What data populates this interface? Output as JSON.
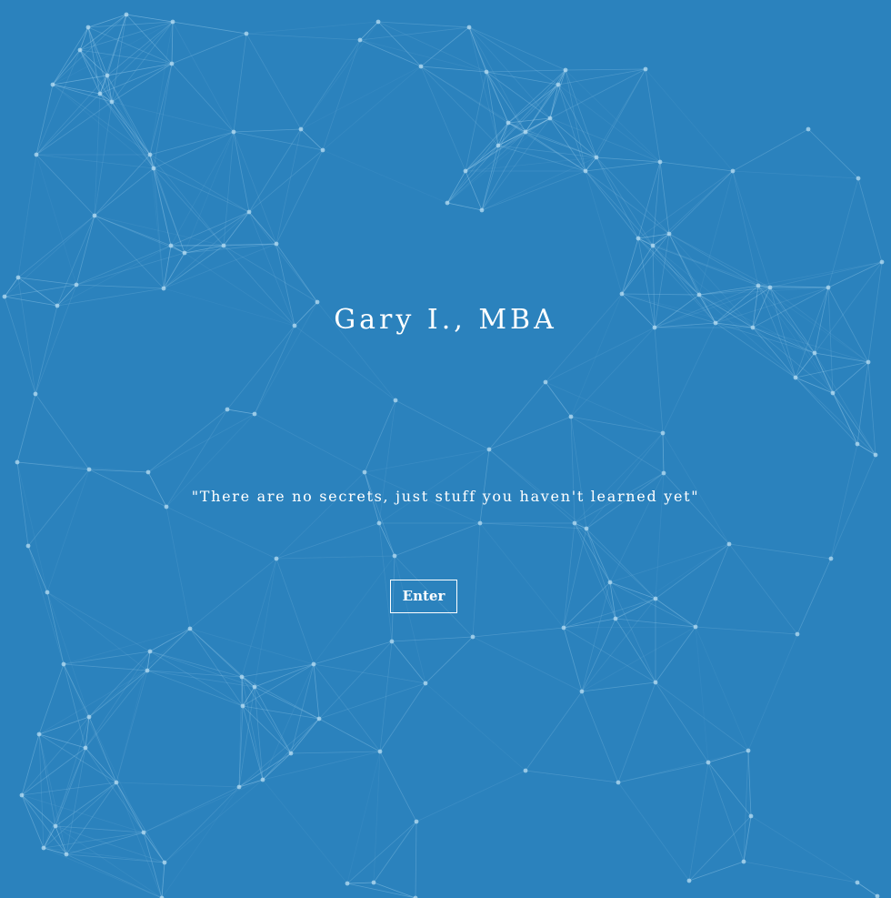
{
  "hero": {
    "title": "Gary I., MBA",
    "quote": "\"There are no secrets, just stuff you haven't learned yet\"",
    "enter_label": "Enter"
  },
  "theme": {
    "background": "#2b82bd",
    "line_color": "#9fd0ee",
    "node_color": "#b7dcf2",
    "text_color": "#ffffff"
  }
}
